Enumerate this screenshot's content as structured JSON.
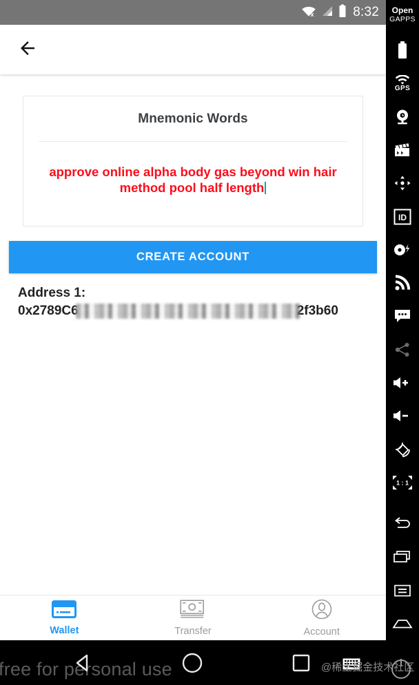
{
  "statusbar": {
    "time": "8:32",
    "icons": [
      "wifi-off-icon",
      "cellular-signal-icon",
      "battery-icon"
    ]
  },
  "toolbar": {
    "back_label": "back-arrow"
  },
  "card": {
    "title": "Mnemonic Words",
    "mnemonic": "approve online alpha body gas beyond win hair method pool half length"
  },
  "actions": {
    "create_account_label": "CREATE ACCOUNT"
  },
  "address": {
    "label": "Address 1:",
    "prefix": "0x2789C6",
    "suffix": "2f3b60"
  },
  "bottom_nav": {
    "items": [
      {
        "label": "Wallet",
        "icon": "credit-card-icon",
        "active": true
      },
      {
        "label": "Transfer",
        "icon": "banknote-icon",
        "active": false
      },
      {
        "label": "Account",
        "icon": "person-icon",
        "active": false
      }
    ]
  },
  "android_nav": {
    "back": "back-triangle-icon",
    "home": "home-circle-icon",
    "recents": "recents-square-icon",
    "keyboard": "keyboard-icon",
    "watermark_left": "free for personal use",
    "watermark_right": "@稀土掘金技术社区"
  },
  "emulator_sidebar": {
    "gapps_line1": "Open",
    "gapps_line2": "GAPPS",
    "gps_label": "GPS",
    "scale_label": "1 : 1",
    "id_label": "ID",
    "items": [
      "battery-icon",
      "gps-icon",
      "webcam-icon",
      "clapperboard-icon",
      "dpad-icon",
      "id-badge-icon",
      "baseband-icon",
      "network-icon",
      "sms-icon",
      "share-icon",
      "volume-up-icon",
      "volume-down-icon",
      "rotate-icon",
      "scale-1-1-icon",
      "back-icon",
      "recents-icon",
      "menu-icon",
      "home-icon"
    ]
  },
  "colors": {
    "accent": "#2196f3",
    "mnemonic_text": "#fc0d1b",
    "caret": "#0aa79b",
    "statusbar_bg": "#757575"
  }
}
